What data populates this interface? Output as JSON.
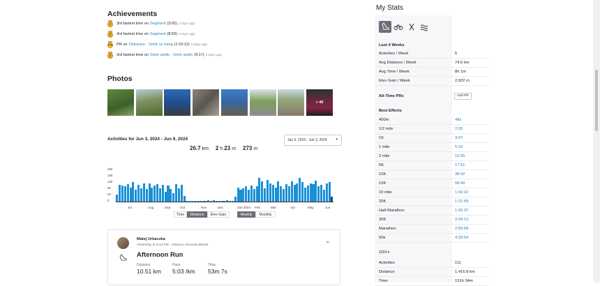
{
  "achievements": {
    "title": "Achievements",
    "items": [
      {
        "prefix": "3rd fastest time on",
        "link": "Segment",
        "suffix": "(3:02)",
        "ago": "3 days ago",
        "medal": "3"
      },
      {
        "prefix": "3rd fastest time on",
        "link": "Segment",
        "suffix": "(8:59)",
        "ago": "3 days ago",
        "medal": "3"
      },
      {
        "prefix": "PR on",
        "link": "Ostravice - Smrk 1x hang",
        "suffix": "(1:10:11)",
        "ago": "3 days ago",
        "medal": "PR"
      },
      {
        "prefix": "3rd fastest time on",
        "link": "Smrk sedlo - Smrk sedlo",
        "suffix": "(9:17)",
        "ago": "3 days ago",
        "medal": "3"
      }
    ]
  },
  "photos": {
    "title": "Photos",
    "more_label": "+ 40"
  },
  "activities": {
    "title": "Activities for Jun 3, 2024 - Jun 9, 2024",
    "range_select": "Jun 5, 2023 - Jun 3, 2024",
    "distance_val": "26.7",
    "distance_unit": "km",
    "time_h": "2",
    "time_h_unit": "h",
    "time_m": "23",
    "time_m_unit": "m",
    "elev_val": "273",
    "elev_unit": "m",
    "buttons": {
      "time": "Time",
      "distance": "Distance",
      "elev": "Elev Gain",
      "weekly": "Weekly",
      "monthly": "Monthly"
    }
  },
  "chart_data": {
    "type": "bar",
    "yticks": [
      "200",
      "160",
      "120",
      "80",
      "40",
      "0"
    ],
    "ylim": [
      0,
      200
    ],
    "xticks": [
      "Jul",
      "Aug",
      "Sep",
      "Oct",
      "Nov",
      "Dec",
      "Jan 2024",
      "Feb",
      "Mar",
      "Apr",
      "May",
      "Jun"
    ],
    "values": [
      40,
      100,
      95,
      90,
      105,
      85,
      115,
      70,
      100,
      80,
      110,
      75,
      110,
      85,
      95,
      105,
      80,
      100,
      60,
      95,
      75,
      50,
      105,
      80,
      100,
      35,
      5,
      4,
      3,
      5,
      3,
      6,
      4,
      5,
      7,
      4,
      8,
      5,
      6,
      3,
      5,
      7,
      4,
      6,
      30,
      85,
      70,
      80,
      90,
      70,
      95,
      75,
      90,
      140,
      120,
      80,
      130,
      110,
      100,
      85,
      120,
      90,
      75,
      105,
      90,
      120,
      100,
      110,
      140,
      115,
      85,
      95,
      110,
      105,
      125,
      90,
      100,
      70,
      110,
      115,
      30
    ]
  },
  "feed": {
    "athlete": "Matej Urbaczka",
    "meta": "Yesterday at 3:13 PM · Ostrava, Moravia-Silesia",
    "title": "Afternoon Run",
    "stats": [
      {
        "label": "Distance",
        "value": "10.51 km"
      },
      {
        "label": "Pace",
        "value": "5:03 /km"
      },
      {
        "label": "Time",
        "value": "53m 7s"
      }
    ]
  },
  "my_stats": {
    "title": "My Stats",
    "last4_title": "Last 4 Weeks",
    "last4": [
      {
        "label": "Activities / Week",
        "value": "5"
      },
      {
        "label": "Avg Distance / Week",
        "value": "74.6 km"
      },
      {
        "label": "Avg Time / Week",
        "value": "8h 1m"
      },
      {
        "label": "Elev Gain / Week",
        "value": "2,922 m"
      }
    ],
    "prs_title": "All-Time PRs",
    "add_pr": "Add PR",
    "best_title": "Best Efforts",
    "best": [
      {
        "label": "400m",
        "value": "48s"
      },
      {
        "label": "1/2 mile",
        "value": "2:20"
      },
      {
        "label": "1K",
        "value": "3:07"
      },
      {
        "label": "1 mile",
        "value": "5:10"
      },
      {
        "label": "2 mile",
        "value": "10:35"
      },
      {
        "label": "5K",
        "value": "17:51"
      },
      {
        "label": "10K",
        "value": "38:42"
      },
      {
        "label": "15K",
        "value": "58:40"
      },
      {
        "label": "10 mile",
        "value": "1:03:10"
      },
      {
        "label": "20K",
        "value": "1:21:59"
      },
      {
        "label": "Half-Marathon",
        "value": "1:26:37"
      },
      {
        "label": "30K",
        "value": "2:04:13"
      },
      {
        "label": "Marathon",
        "value": "2:55:58"
      },
      {
        "label": "50k",
        "value": "4:33:54"
      }
    ],
    "year_select": "2024",
    "year": [
      {
        "label": "Activities",
        "value": "111"
      },
      {
        "label": "Distance",
        "value": "1,416.8 km"
      },
      {
        "label": "Time",
        "value": "151h 34m"
      }
    ]
  }
}
